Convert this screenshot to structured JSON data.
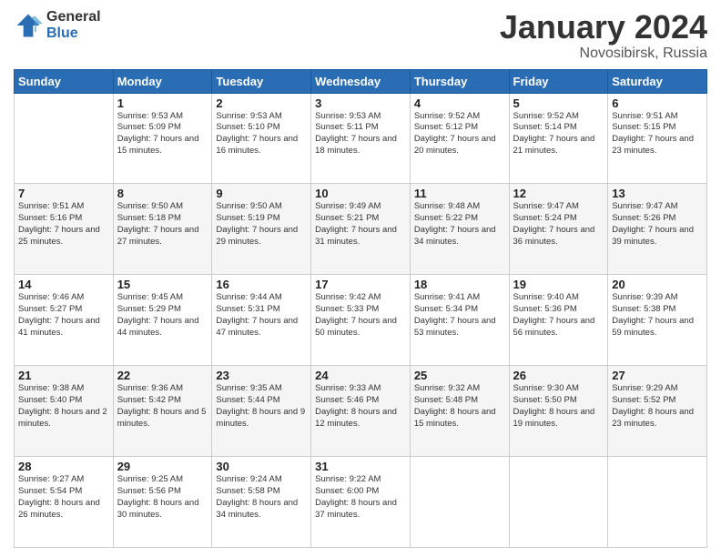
{
  "header": {
    "logo_general": "General",
    "logo_blue": "Blue",
    "month_title": "January 2024",
    "subtitle": "Novosibirsk, Russia"
  },
  "weekdays": [
    "Sunday",
    "Monday",
    "Tuesday",
    "Wednesday",
    "Thursday",
    "Friday",
    "Saturday"
  ],
  "weeks": [
    [
      {
        "day": "",
        "info": ""
      },
      {
        "day": "1",
        "info": "Sunrise: 9:53 AM\nSunset: 5:09 PM\nDaylight: 7 hours\nand 15 minutes."
      },
      {
        "day": "2",
        "info": "Sunrise: 9:53 AM\nSunset: 5:10 PM\nDaylight: 7 hours\nand 16 minutes."
      },
      {
        "day": "3",
        "info": "Sunrise: 9:53 AM\nSunset: 5:11 PM\nDaylight: 7 hours\nand 18 minutes."
      },
      {
        "day": "4",
        "info": "Sunrise: 9:52 AM\nSunset: 5:12 PM\nDaylight: 7 hours\nand 20 minutes."
      },
      {
        "day": "5",
        "info": "Sunrise: 9:52 AM\nSunset: 5:14 PM\nDaylight: 7 hours\nand 21 minutes."
      },
      {
        "day": "6",
        "info": "Sunrise: 9:51 AM\nSunset: 5:15 PM\nDaylight: 7 hours\nand 23 minutes."
      }
    ],
    [
      {
        "day": "7",
        "info": "Sunrise: 9:51 AM\nSunset: 5:16 PM\nDaylight: 7 hours\nand 25 minutes."
      },
      {
        "day": "8",
        "info": "Sunrise: 9:50 AM\nSunset: 5:18 PM\nDaylight: 7 hours\nand 27 minutes."
      },
      {
        "day": "9",
        "info": "Sunrise: 9:50 AM\nSunset: 5:19 PM\nDaylight: 7 hours\nand 29 minutes."
      },
      {
        "day": "10",
        "info": "Sunrise: 9:49 AM\nSunset: 5:21 PM\nDaylight: 7 hours\nand 31 minutes."
      },
      {
        "day": "11",
        "info": "Sunrise: 9:48 AM\nSunset: 5:22 PM\nDaylight: 7 hours\nand 34 minutes."
      },
      {
        "day": "12",
        "info": "Sunrise: 9:47 AM\nSunset: 5:24 PM\nDaylight: 7 hours\nand 36 minutes."
      },
      {
        "day": "13",
        "info": "Sunrise: 9:47 AM\nSunset: 5:26 PM\nDaylight: 7 hours\nand 39 minutes."
      }
    ],
    [
      {
        "day": "14",
        "info": "Sunrise: 9:46 AM\nSunset: 5:27 PM\nDaylight: 7 hours\nand 41 minutes."
      },
      {
        "day": "15",
        "info": "Sunrise: 9:45 AM\nSunset: 5:29 PM\nDaylight: 7 hours\nand 44 minutes."
      },
      {
        "day": "16",
        "info": "Sunrise: 9:44 AM\nSunset: 5:31 PM\nDaylight: 7 hours\nand 47 minutes."
      },
      {
        "day": "17",
        "info": "Sunrise: 9:42 AM\nSunset: 5:33 PM\nDaylight: 7 hours\nand 50 minutes."
      },
      {
        "day": "18",
        "info": "Sunrise: 9:41 AM\nSunset: 5:34 PM\nDaylight: 7 hours\nand 53 minutes."
      },
      {
        "day": "19",
        "info": "Sunrise: 9:40 AM\nSunset: 5:36 PM\nDaylight: 7 hours\nand 56 minutes."
      },
      {
        "day": "20",
        "info": "Sunrise: 9:39 AM\nSunset: 5:38 PM\nDaylight: 7 hours\nand 59 minutes."
      }
    ],
    [
      {
        "day": "21",
        "info": "Sunrise: 9:38 AM\nSunset: 5:40 PM\nDaylight: 8 hours\nand 2 minutes."
      },
      {
        "day": "22",
        "info": "Sunrise: 9:36 AM\nSunset: 5:42 PM\nDaylight: 8 hours\nand 5 minutes."
      },
      {
        "day": "23",
        "info": "Sunrise: 9:35 AM\nSunset: 5:44 PM\nDaylight: 8 hours\nand 9 minutes."
      },
      {
        "day": "24",
        "info": "Sunrise: 9:33 AM\nSunset: 5:46 PM\nDaylight: 8 hours\nand 12 minutes."
      },
      {
        "day": "25",
        "info": "Sunrise: 9:32 AM\nSunset: 5:48 PM\nDaylight: 8 hours\nand 15 minutes."
      },
      {
        "day": "26",
        "info": "Sunrise: 9:30 AM\nSunset: 5:50 PM\nDaylight: 8 hours\nand 19 minutes."
      },
      {
        "day": "27",
        "info": "Sunrise: 9:29 AM\nSunset: 5:52 PM\nDaylight: 8 hours\nand 23 minutes."
      }
    ],
    [
      {
        "day": "28",
        "info": "Sunrise: 9:27 AM\nSunset: 5:54 PM\nDaylight: 8 hours\nand 26 minutes."
      },
      {
        "day": "29",
        "info": "Sunrise: 9:25 AM\nSunset: 5:56 PM\nDaylight: 8 hours\nand 30 minutes."
      },
      {
        "day": "30",
        "info": "Sunrise: 9:24 AM\nSunset: 5:58 PM\nDaylight: 8 hours\nand 34 minutes."
      },
      {
        "day": "31",
        "info": "Sunrise: 9:22 AM\nSunset: 6:00 PM\nDaylight: 8 hours\nand 37 minutes."
      },
      {
        "day": "",
        "info": ""
      },
      {
        "day": "",
        "info": ""
      },
      {
        "day": "",
        "info": ""
      }
    ]
  ]
}
